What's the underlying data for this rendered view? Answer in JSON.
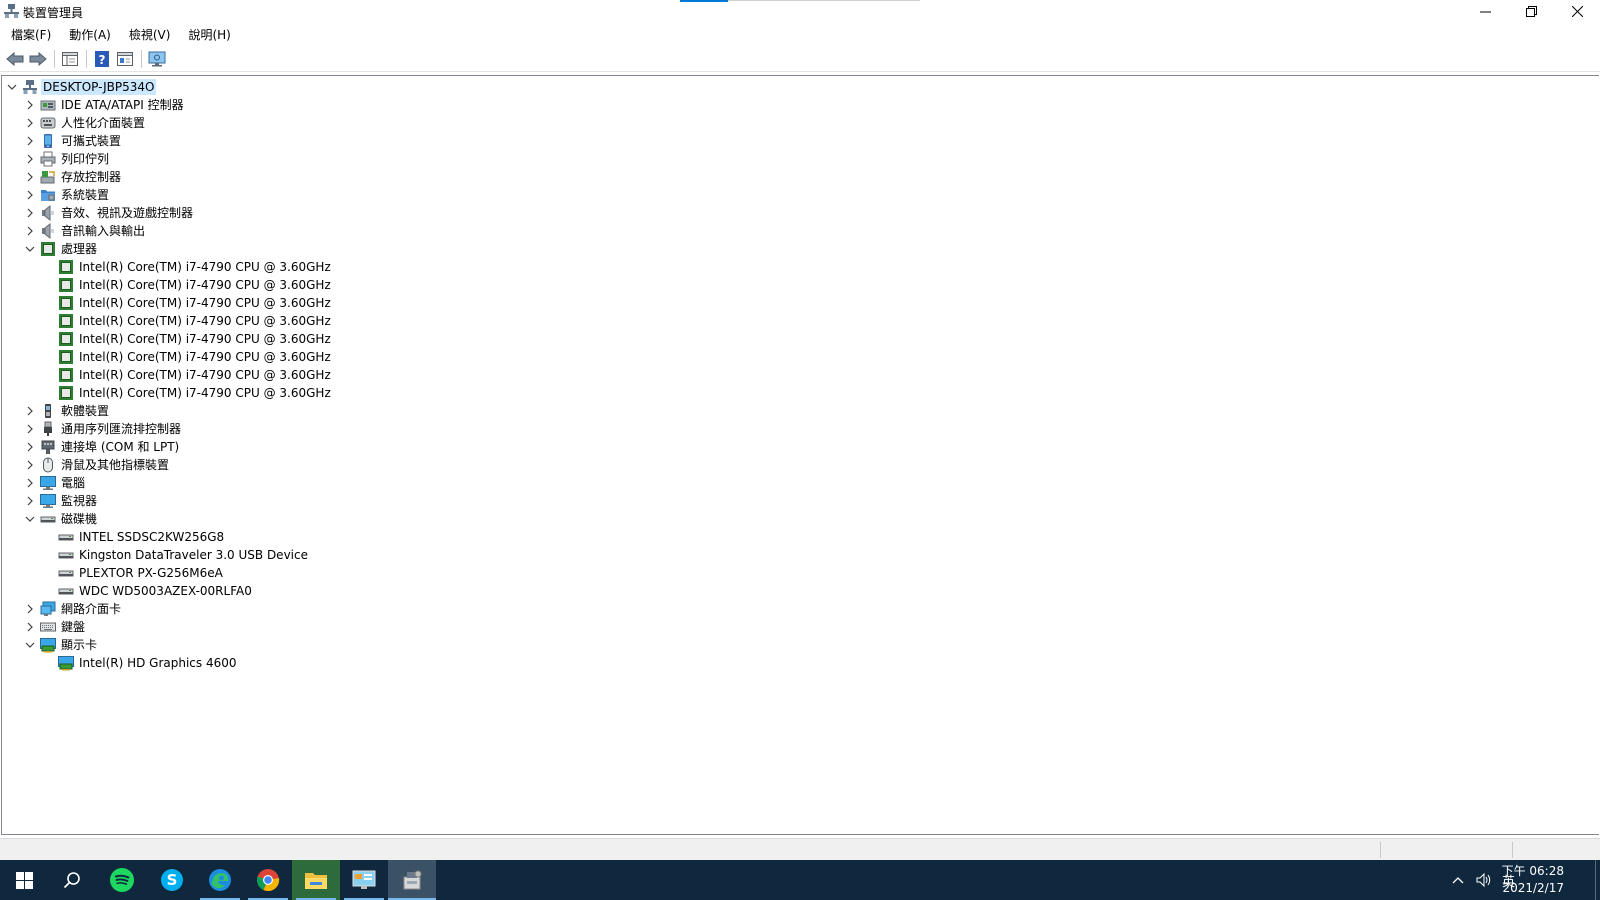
{
  "window": {
    "title": "裝置管理員"
  },
  "menu": [
    "檔案(F)",
    "動作(A)",
    "檢視(V)",
    "說明(H)"
  ],
  "tree": [
    {
      "label": "DESKTOP-JBP534O",
      "level": 0,
      "expander": "open",
      "icon": "computer-icon",
      "selected": true
    },
    {
      "label": "IDE ATA/ATAPI 控制器",
      "level": 1,
      "expander": "closed",
      "icon": "ide-controller-icon"
    },
    {
      "label": "人性化介面裝置",
      "level": 1,
      "expander": "closed",
      "icon": "hid-icon"
    },
    {
      "label": "可攜式裝置",
      "level": 1,
      "expander": "closed",
      "icon": "portable-device-icon"
    },
    {
      "label": "列印佇列",
      "level": 1,
      "expander": "closed",
      "icon": "printer-icon"
    },
    {
      "label": "存放控制器",
      "level": 1,
      "expander": "closed",
      "icon": "storage-controller-icon"
    },
    {
      "label": "系統裝置",
      "level": 1,
      "expander": "closed",
      "icon": "system-device-icon"
    },
    {
      "label": "音效、視訊及遊戲控制器",
      "level": 1,
      "expander": "closed",
      "icon": "speaker-icon"
    },
    {
      "label": "音訊輸入與輸出",
      "level": 1,
      "expander": "closed",
      "icon": "speaker-icon"
    },
    {
      "label": "處理器",
      "level": 1,
      "expander": "open",
      "icon": "processor-icon"
    },
    {
      "label": "Intel(R) Core(TM) i7-4790 CPU @ 3.60GHz",
      "level": 2,
      "expander": "none",
      "icon": "processor-icon"
    },
    {
      "label": "Intel(R) Core(TM) i7-4790 CPU @ 3.60GHz",
      "level": 2,
      "expander": "none",
      "icon": "processor-icon"
    },
    {
      "label": "Intel(R) Core(TM) i7-4790 CPU @ 3.60GHz",
      "level": 2,
      "expander": "none",
      "icon": "processor-icon"
    },
    {
      "label": "Intel(R) Core(TM) i7-4790 CPU @ 3.60GHz",
      "level": 2,
      "expander": "none",
      "icon": "processor-icon"
    },
    {
      "label": "Intel(R) Core(TM) i7-4790 CPU @ 3.60GHz",
      "level": 2,
      "expander": "none",
      "icon": "processor-icon"
    },
    {
      "label": "Intel(R) Core(TM) i7-4790 CPU @ 3.60GHz",
      "level": 2,
      "expander": "none",
      "icon": "processor-icon"
    },
    {
      "label": "Intel(R) Core(TM) i7-4790 CPU @ 3.60GHz",
      "level": 2,
      "expander": "none",
      "icon": "processor-icon"
    },
    {
      "label": "Intel(R) Core(TM) i7-4790 CPU @ 3.60GHz",
      "level": 2,
      "expander": "none",
      "icon": "processor-icon"
    },
    {
      "label": "軟體裝置",
      "level": 1,
      "expander": "closed",
      "icon": "software-device-icon"
    },
    {
      "label": "通用序列匯流排控制器",
      "level": 1,
      "expander": "closed",
      "icon": "usb-icon"
    },
    {
      "label": "連接埠 (COM 和 LPT)",
      "level": 1,
      "expander": "closed",
      "icon": "port-icon"
    },
    {
      "label": "滑鼠及其他指標裝置",
      "level": 1,
      "expander": "closed",
      "icon": "mouse-icon"
    },
    {
      "label": "電腦",
      "level": 1,
      "expander": "closed",
      "icon": "monitor-icon"
    },
    {
      "label": "監視器",
      "level": 1,
      "expander": "closed",
      "icon": "monitor-icon"
    },
    {
      "label": "磁碟機",
      "level": 1,
      "expander": "open",
      "icon": "disk-drive-icon"
    },
    {
      "label": "INTEL SSDSC2KW256G8",
      "level": 2,
      "expander": "none",
      "icon": "disk-drive-icon"
    },
    {
      "label": "Kingston DataTraveler 3.0 USB Device",
      "level": 2,
      "expander": "none",
      "icon": "disk-drive-icon"
    },
    {
      "label": "PLEXTOR PX-G256M6eA",
      "level": 2,
      "expander": "none",
      "icon": "disk-drive-icon"
    },
    {
      "label": "WDC WD5003AZEX-00RLFA0",
      "level": 2,
      "expander": "none",
      "icon": "disk-drive-icon"
    },
    {
      "label": "網路介面卡",
      "level": 1,
      "expander": "closed",
      "icon": "network-adapter-icon"
    },
    {
      "label": "鍵盤",
      "level": 1,
      "expander": "closed",
      "icon": "keyboard-icon"
    },
    {
      "label": "顯示卡",
      "level": 1,
      "expander": "open",
      "icon": "display-adapter-icon"
    },
    {
      "label": "Intel(R) HD Graphics 4600",
      "level": 2,
      "expander": "none",
      "icon": "display-adapter-icon"
    }
  ],
  "taskbar": {
    "apps": [
      "start-icon",
      "search-icon",
      "spotify-icon",
      "skype-icon",
      "edge-icon",
      "chrome-icon",
      "file-explorer-icon",
      "control-panel-icon",
      "device-manager-icon"
    ],
    "ime": "英",
    "time": "下午 06:28",
    "date": "2021/2/17"
  },
  "colors": {
    "selection": "#cce8ff",
    "taskbar": "#10283d",
    "accent": "#0078d7"
  }
}
